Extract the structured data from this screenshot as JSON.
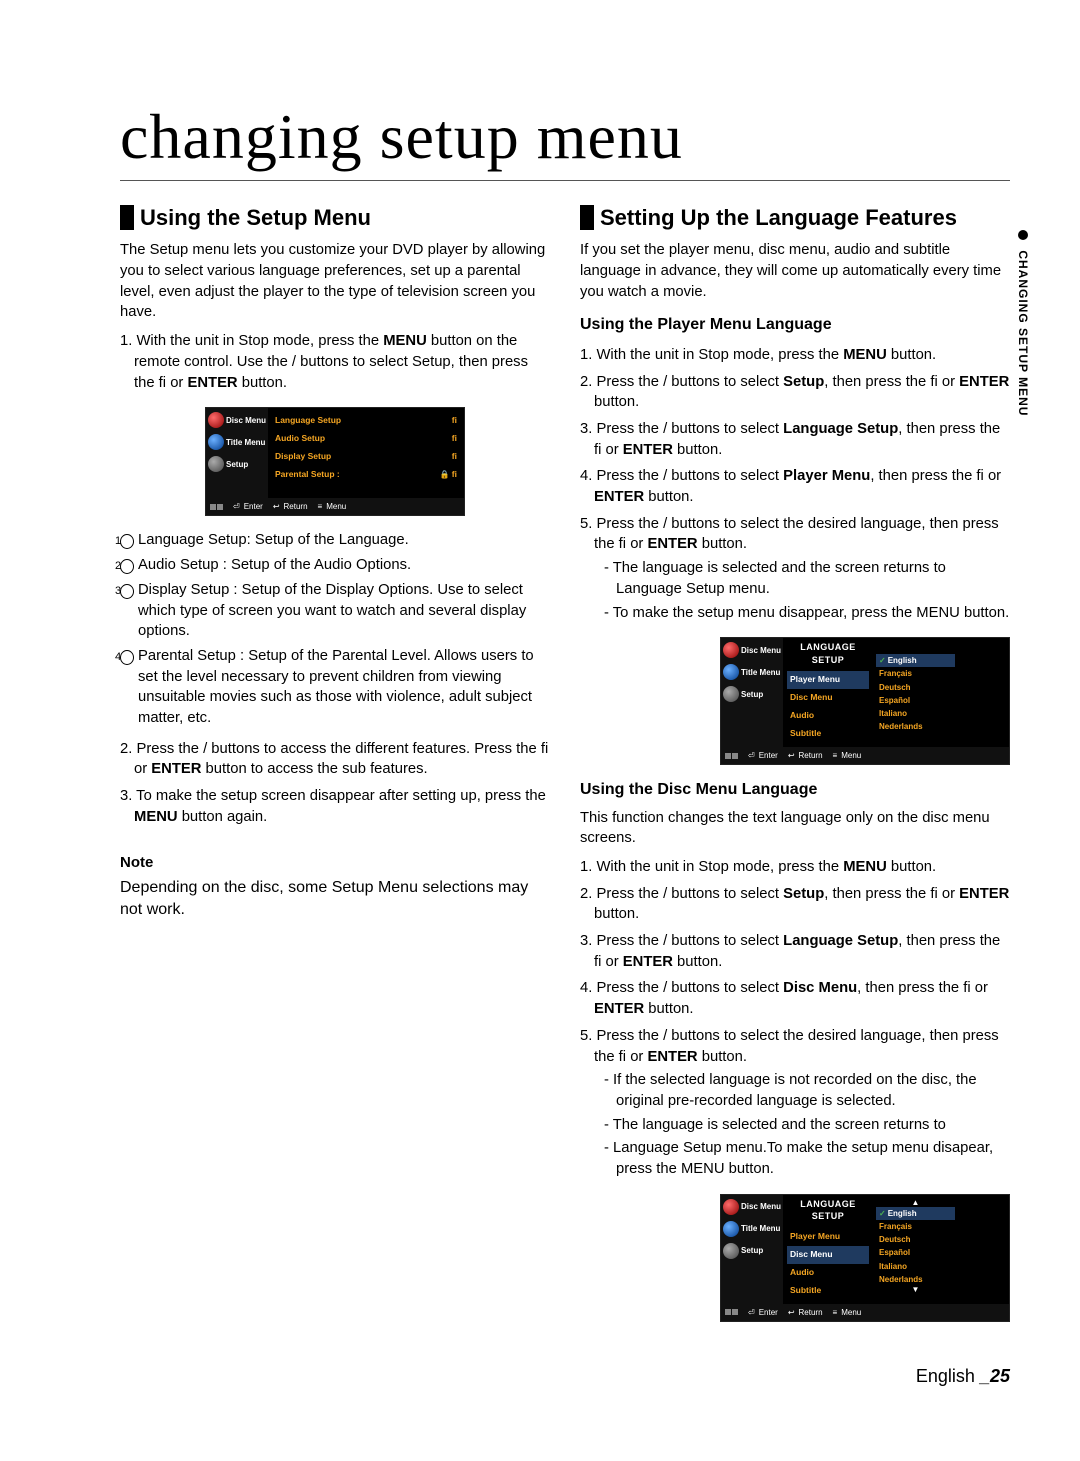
{
  "page": {
    "title": "changing setup menu",
    "side_tab": "CHANGING SETUP MENU",
    "footer_lang": "English ",
    "footer_page": "_25"
  },
  "left": {
    "h1": "Using the Setup Menu",
    "intro": "The Setup menu lets you customize your DVD player by allowing you to select various language preferences, set up a parental level, even adjust the player to the type of television screen you have.",
    "step1_a": "1. With the unit in Stop mode, press the ",
    "step1_b": "MENU",
    "step1_c": " button on the remote control.  Use the       /       buttons to select Setup, then  press the ﬁ   or ",
    "step1_d": "ENTER",
    "step1_e": " button.",
    "bullets": [
      {
        "label": "Language Setup",
        "desc": ": Setup of the Language."
      },
      {
        "label": "Audio Setup",
        "desc": " : Setup of the Audio Options."
      },
      {
        "label": "Display Setup",
        "desc": " : Setup of the Display Options. Use to select which type of screen you want to watch and several display options."
      },
      {
        "label": "Parental Setup",
        "desc": " : Setup of the Parental Level. Allows users to set the level necessary to prevent children from viewing unsuitable movies such as those with violence, adult subject matter, etc."
      }
    ],
    "step2_a": "2. Press the       /       buttons to access the different  features. Press the ﬁ   or ",
    "step2_b": "ENTER",
    "step2_c": " button to access the sub features.",
    "step3_a": "3. To make the setup screen disappear after setting up, press the ",
    "step3_b": "MENU",
    "step3_c": " button again.",
    "note_label": "Note",
    "note_text": "Depending on the disc, some Setup Menu selections may not work."
  },
  "right": {
    "h1": "Setting Up the Language Features",
    "intro": "If you set the player menu, disc menu, audio and subtitle language in advance, they will come up automatically every time you watch a movie.",
    "sub_a": "Using the Player Menu Language",
    "a_steps": [
      "1. With the unit in Stop mode, press the <b>MENU</b> button.",
      "2. Press the       /       buttons to select <b>Setup</b>, then press the ﬁ   or <b>ENTER</b> button.",
      "3. Press the       /       buttons to select <b>Language Setup</b>, then press the ﬁ   or <b>ENTER</b> button.",
      "4. Press the       /       buttons to select <b>Player Menu</b>, then press the ﬁ   or <b>ENTER</b> button.",
      "5. Press the       /       buttons to select the desired language, then press the ﬁ   or <b>ENTER</b> button."
    ],
    "a_sub": [
      "- The language is selected and the screen returns to Language Setup menu.",
      "- To make the setup menu disappear, press the MENU button."
    ],
    "sub_b": "Using the Disc Menu Language",
    "b_intro": "This function changes the text language only on the disc menu screens.",
    "b_steps": [
      "1. With the unit in Stop mode, press the <b>MENU</b> button.",
      "2. Press the       /       buttons to select <b>Setup</b>, then press the ﬁ   or <b>ENTER</b> button.",
      "3. Press the       /       buttons to select <b>Language Setup</b>, then press the ﬁ   or <b>ENTER</b> button.",
      "4. Press the       /       buttons to select <b>Disc Menu</b>, then press the ﬁ   or <b>ENTER</b>  button.",
      "5. Press the       /       buttons to select the desired language, then press the ﬁ   or <b>ENTER</b> button."
    ],
    "b_sub": [
      "- If the selected language is not recorded on  the disc, the original pre-recorded language is selected.",
      "- The language is selected and the screen returns to",
      "- Language Setup menu.To make the setup menu disapear, press the MENU button."
    ]
  },
  "osd1": {
    "left": [
      "Disc Menu",
      "Title Menu",
      "Setup"
    ],
    "rows": [
      "Language Setup",
      "Audio Setup",
      "Display Setup",
      "Parental Setup :"
    ],
    "foot": [
      "Enter",
      "Return",
      "Menu"
    ]
  },
  "osd2": {
    "title": "LANGUAGE SETUP",
    "left": [
      "Disc Menu",
      "Title Menu",
      "Setup"
    ],
    "mid": [
      "Player Menu",
      "Disc Menu",
      "Audio",
      "Subtitle"
    ],
    "right": [
      "English",
      "Français",
      "Deutsch",
      "Español",
      "Italiano",
      "Nederlands"
    ],
    "selected": "Player Menu",
    "foot": [
      "Enter",
      "Return",
      "Menu"
    ]
  },
  "osd3": {
    "title": "LANGUAGE SETUP",
    "left": [
      "Disc Menu",
      "Title Menu",
      "Setup"
    ],
    "mid": [
      "Player Menu",
      "Disc Menu",
      "Audio",
      "Subtitle"
    ],
    "right": [
      "English",
      "Français",
      "Deutsch",
      "Español",
      "Italiano",
      "Nederlands"
    ],
    "selected": "Disc Menu",
    "foot": [
      "Enter",
      "Return",
      "Menu"
    ]
  }
}
